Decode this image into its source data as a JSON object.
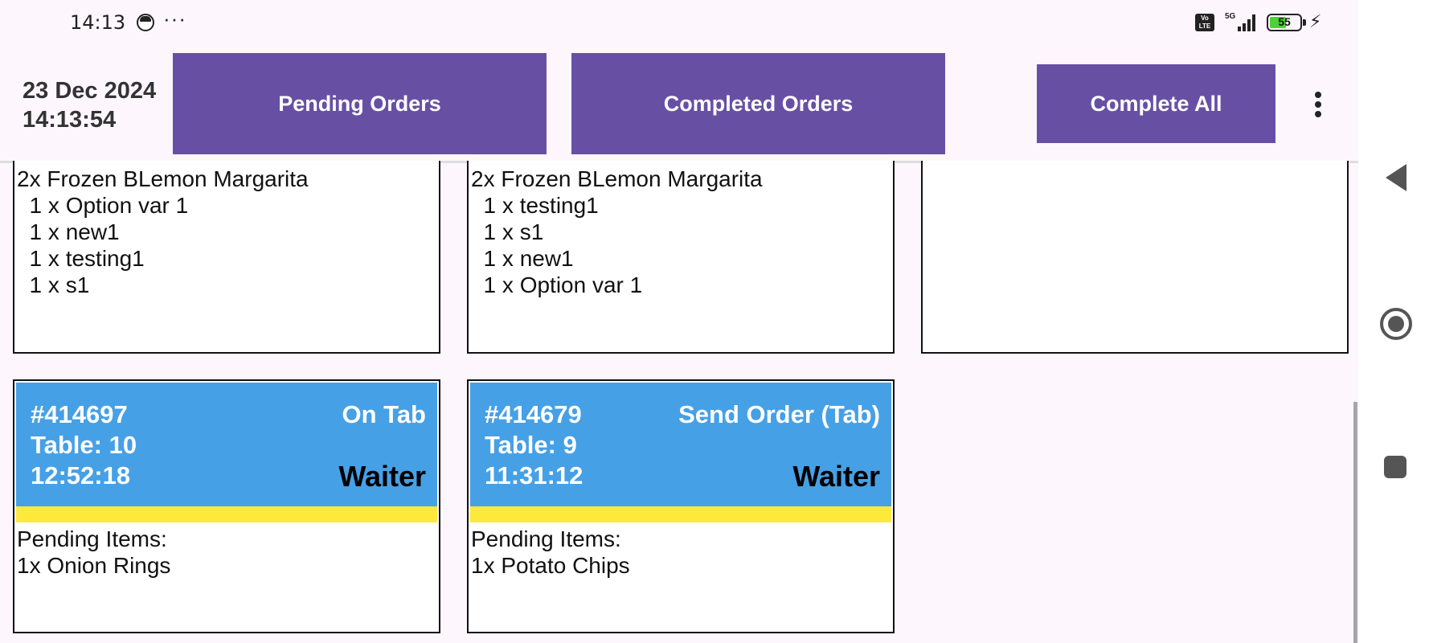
{
  "status_bar": {
    "time": "14:13",
    "dots": "···",
    "network": "5G",
    "volte": "Vo LTE",
    "battery": "55",
    "battery_level_percent": 55
  },
  "header": {
    "date": "23 Dec 2024",
    "time": "14:13:54",
    "pending_label": "Pending Orders",
    "completed_label": "Completed Orders",
    "complete_all_label": "Complete All"
  },
  "top_cards": [
    {
      "items": "2x Frozen BLemon Margarita\n  1 x Option var 1\n  1 x new1\n  1 x testing1\n  1 x s1"
    },
    {
      "items": "2x Frozen BLemon Margarita\n  1 x testing1\n  1 x s1\n  1 x new1\n  1 x Option var 1"
    },
    {
      "items": ""
    }
  ],
  "orders": [
    {
      "id": "#414697",
      "table": "Table: 10",
      "time": "12:52:18",
      "status": "On Tab",
      "role": "Waiter",
      "items": "Pending Items:\n1x Onion Rings"
    },
    {
      "id": "#414679",
      "table": "Table: 9",
      "time": "11:31:12",
      "status": "Send Order (Tab)",
      "role": "Waiter",
      "items": "Pending Items:\n1x Potato Chips"
    }
  ],
  "colors": {
    "primary": "#6750a4",
    "card_header": "#46a0e6",
    "card_accent": "#fde93c",
    "background": "#fdf7fd"
  }
}
